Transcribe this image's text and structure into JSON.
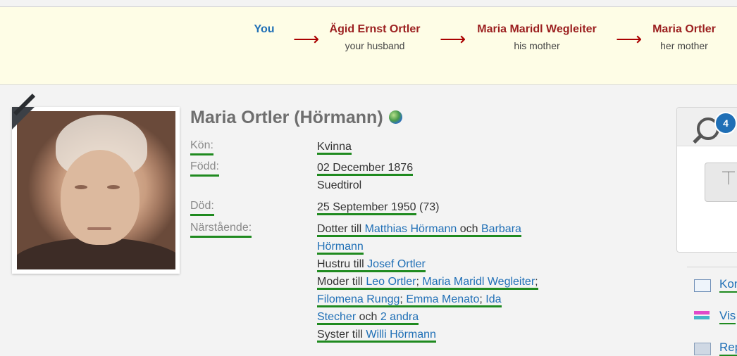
{
  "relationship_path": [
    {
      "name": "You",
      "relation": ""
    },
    {
      "name": "Ägid Ernst Ortler",
      "relation": "your husband"
    },
    {
      "name": "Maria Maridl Wegleiter",
      "relation": "his mother"
    },
    {
      "name": "Maria Ortler",
      "relation": "her mother"
    }
  ],
  "arrow_glyph": "⟶",
  "profile": {
    "name": "Maria Ortler (Hörmann)",
    "facts": {
      "gender_label": "Kön:",
      "gender": "Kvinna",
      "born_label": "Född:",
      "born_date": "02 December 1876",
      "born_place": "Suedtirol",
      "died_label": "Död:",
      "died_date": "25 September 1950",
      "died_age": " (73)",
      "relatives_label": "Närstående:"
    },
    "relatives": {
      "daughter_prefix": "Dotter till ",
      "father": "Matthias Hörmann",
      "och1": " och ",
      "mother_part1": "Barbara",
      "mother_part2": "Hörmann",
      "wife_prefix": "Hustru till ",
      "husband": "Josef Ortler",
      "mother_prefix": "Moder till ",
      "child1": "Leo Ortler",
      "sep": ";",
      "child2": "Maria Maridl Wegleiter",
      "child3": "Filomena Rungg",
      "child4": "Emma Menato",
      "child5_part1": "Ida",
      "child5_part2": "Stecher",
      "och2": " och ",
      "more_children": "2 andra",
      "sister_prefix": "Syster till ",
      "sibling": "Willi Hörmann"
    }
  },
  "sidebar": {
    "matches_badge": "4",
    "links": [
      "Kon",
      "Vis",
      "Rep"
    ]
  },
  "colors": {
    "relation_name": "#9b1f1f",
    "you": "#1f6fb6",
    "link": "#1f6fb6",
    "underline": "#1f8a1f",
    "banner_bg": "#fefde6"
  }
}
